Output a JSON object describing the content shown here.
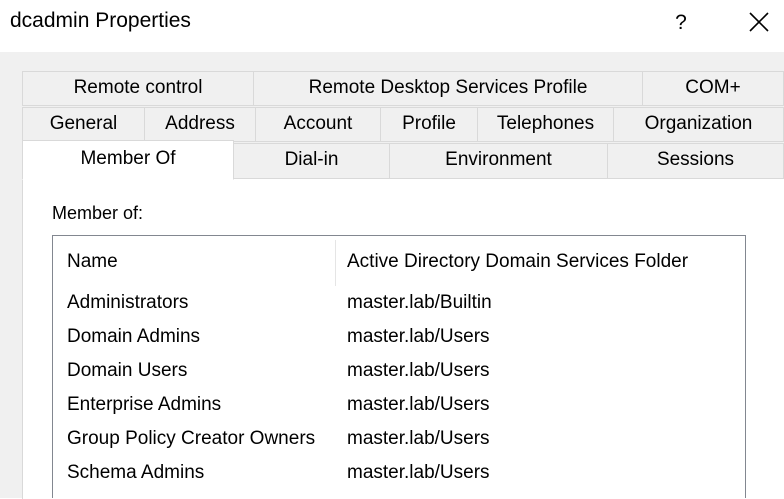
{
  "window": {
    "title": "dcadmin Properties",
    "help_label": "?"
  },
  "tabs": {
    "row1": [
      "Remote control",
      "Remote Desktop Services Profile",
      "COM+"
    ],
    "row2": [
      "General",
      "Address",
      "Account",
      "Profile",
      "Telephones",
      "Organization"
    ],
    "row3": [
      "Member Of",
      "Dial-in",
      "Environment",
      "Sessions"
    ],
    "active": "Member Of"
  },
  "member_of": {
    "label": "Member of:",
    "columns": [
      "Name",
      "Active Directory Domain Services Folder"
    ],
    "rows": [
      {
        "name": "Administrators",
        "folder": "master.lab/Builtin"
      },
      {
        "name": "Domain Admins",
        "folder": "master.lab/Users"
      },
      {
        "name": "Domain Users",
        "folder": "master.lab/Users"
      },
      {
        "name": "Enterprise Admins",
        "folder": "master.lab/Users"
      },
      {
        "name": "Group Policy Creator Owners",
        "folder": "master.lab/Users"
      },
      {
        "name": "Schema Admins",
        "folder": "master.lab/Users"
      }
    ]
  },
  "icons": {
    "close": "close-icon"
  }
}
